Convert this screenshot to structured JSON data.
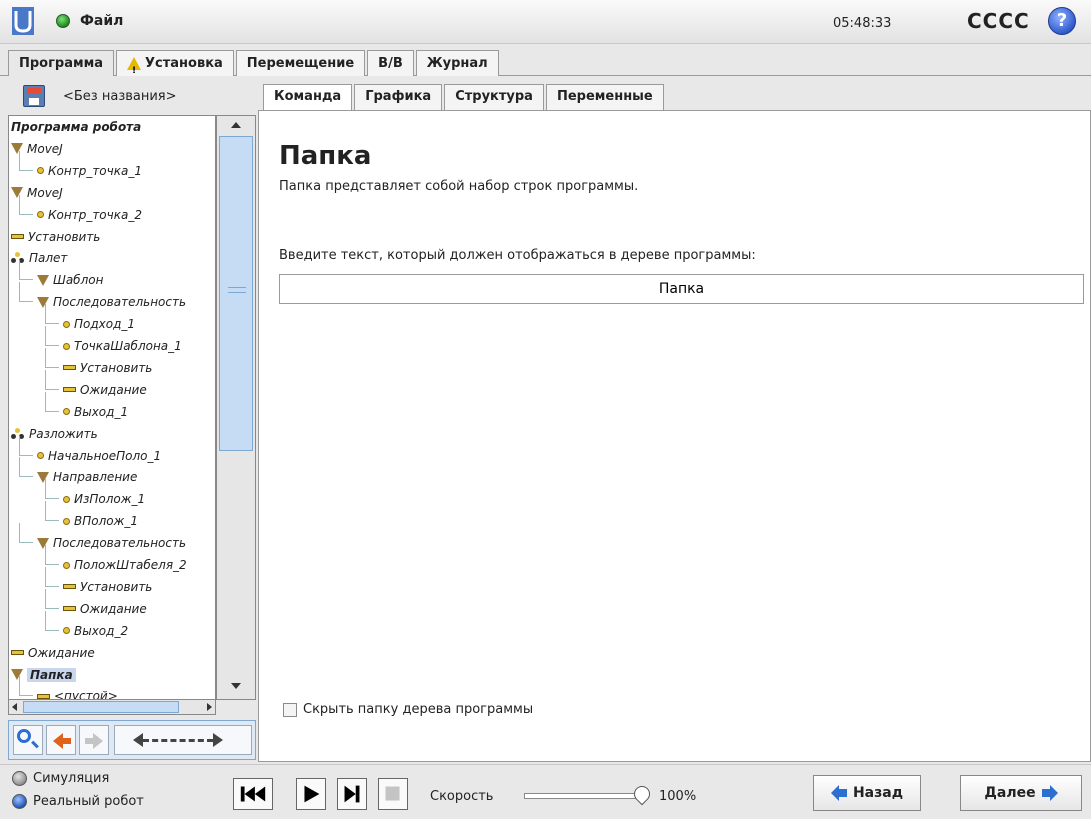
{
  "header": {
    "file_menu": "Файл",
    "clock": "05:48:33",
    "robot_name": "CCCC",
    "help": "?"
  },
  "main_tabs": [
    "Программа",
    "Установка",
    "Перемещение",
    "В/В",
    "Журнал"
  ],
  "left_panel": {
    "program_name": "<Без названия>",
    "tree": [
      {
        "label": "Программа робота",
        "icon": "none",
        "level": 0
      },
      {
        "label": "MoveJ",
        "icon": "triangle",
        "level": 0
      },
      {
        "label": "Контр_точка_1",
        "icon": "dot",
        "level": 1
      },
      {
        "label": "MoveJ",
        "icon": "triangle",
        "level": 0
      },
      {
        "label": "Контр_точка_2",
        "icon": "dot",
        "level": 1
      },
      {
        "label": "Установить",
        "icon": "bar",
        "level": 0
      },
      {
        "label": "Палет",
        "icon": "pallet",
        "level": 0
      },
      {
        "label": "Шаблон",
        "icon": "triangle",
        "level": 1
      },
      {
        "label": "Последовательность",
        "icon": "triangle",
        "level": 1
      },
      {
        "label": "Подход_1",
        "icon": "dot",
        "level": 2
      },
      {
        "label": "ТочкаШаблона_1",
        "icon": "dot",
        "level": 2
      },
      {
        "label": "Установить",
        "icon": "bar",
        "level": 2
      },
      {
        "label": "Ожидание",
        "icon": "bar",
        "level": 2
      },
      {
        "label": "Выход_1",
        "icon": "dot",
        "level": 2
      },
      {
        "label": "Разложить",
        "icon": "pallet",
        "level": 0
      },
      {
        "label": "НачальноеПоло_1",
        "icon": "dot",
        "level": 1
      },
      {
        "label": "Направление",
        "icon": "triangle",
        "level": 1
      },
      {
        "label": "ИзПолож_1",
        "icon": "dot",
        "level": 2
      },
      {
        "label": "ВПолож_1",
        "icon": "dot",
        "level": 2
      },
      {
        "label": "Последовательность",
        "icon": "triangle",
        "level": 1
      },
      {
        "label": "ПоложШтабеля_2",
        "icon": "dot",
        "level": 2
      },
      {
        "label": "Установить",
        "icon": "bar",
        "level": 2
      },
      {
        "label": "Ожидание",
        "icon": "bar",
        "level": 2
      },
      {
        "label": "Выход_2",
        "icon": "dot",
        "level": 2
      },
      {
        "label": "Ожидание",
        "icon": "bar",
        "level": 0
      },
      {
        "label": "Папка",
        "icon": "triangle",
        "level": 0,
        "selected": true
      },
      {
        "label": "<пустой>",
        "icon": "bar",
        "level": 1
      }
    ]
  },
  "sub_tabs": [
    "Команда",
    "Графика",
    "Структура",
    "Переменные"
  ],
  "content": {
    "title": "Папка",
    "description": "Папка представляет собой набор строк программы.",
    "prompt": "Введите текст, который должен отображаться в дереве программы:",
    "folder_name_value": "Папка",
    "hide_checkbox_label": "Скрыть папку дерева программы"
  },
  "bottom": {
    "mode_simulation": "Симуляция",
    "mode_real": "Реальный робот",
    "speed_label": "Скорость",
    "speed_value": "100%",
    "speed_fraction": 1.0,
    "back_button": "Назад",
    "next_button": "Далее"
  },
  "colors": {
    "accent_blue": "#2b6fd0",
    "selection": "#c9d7ee",
    "node_yellow": "#e5c23a",
    "node_brown": "#9b7a3a"
  }
}
